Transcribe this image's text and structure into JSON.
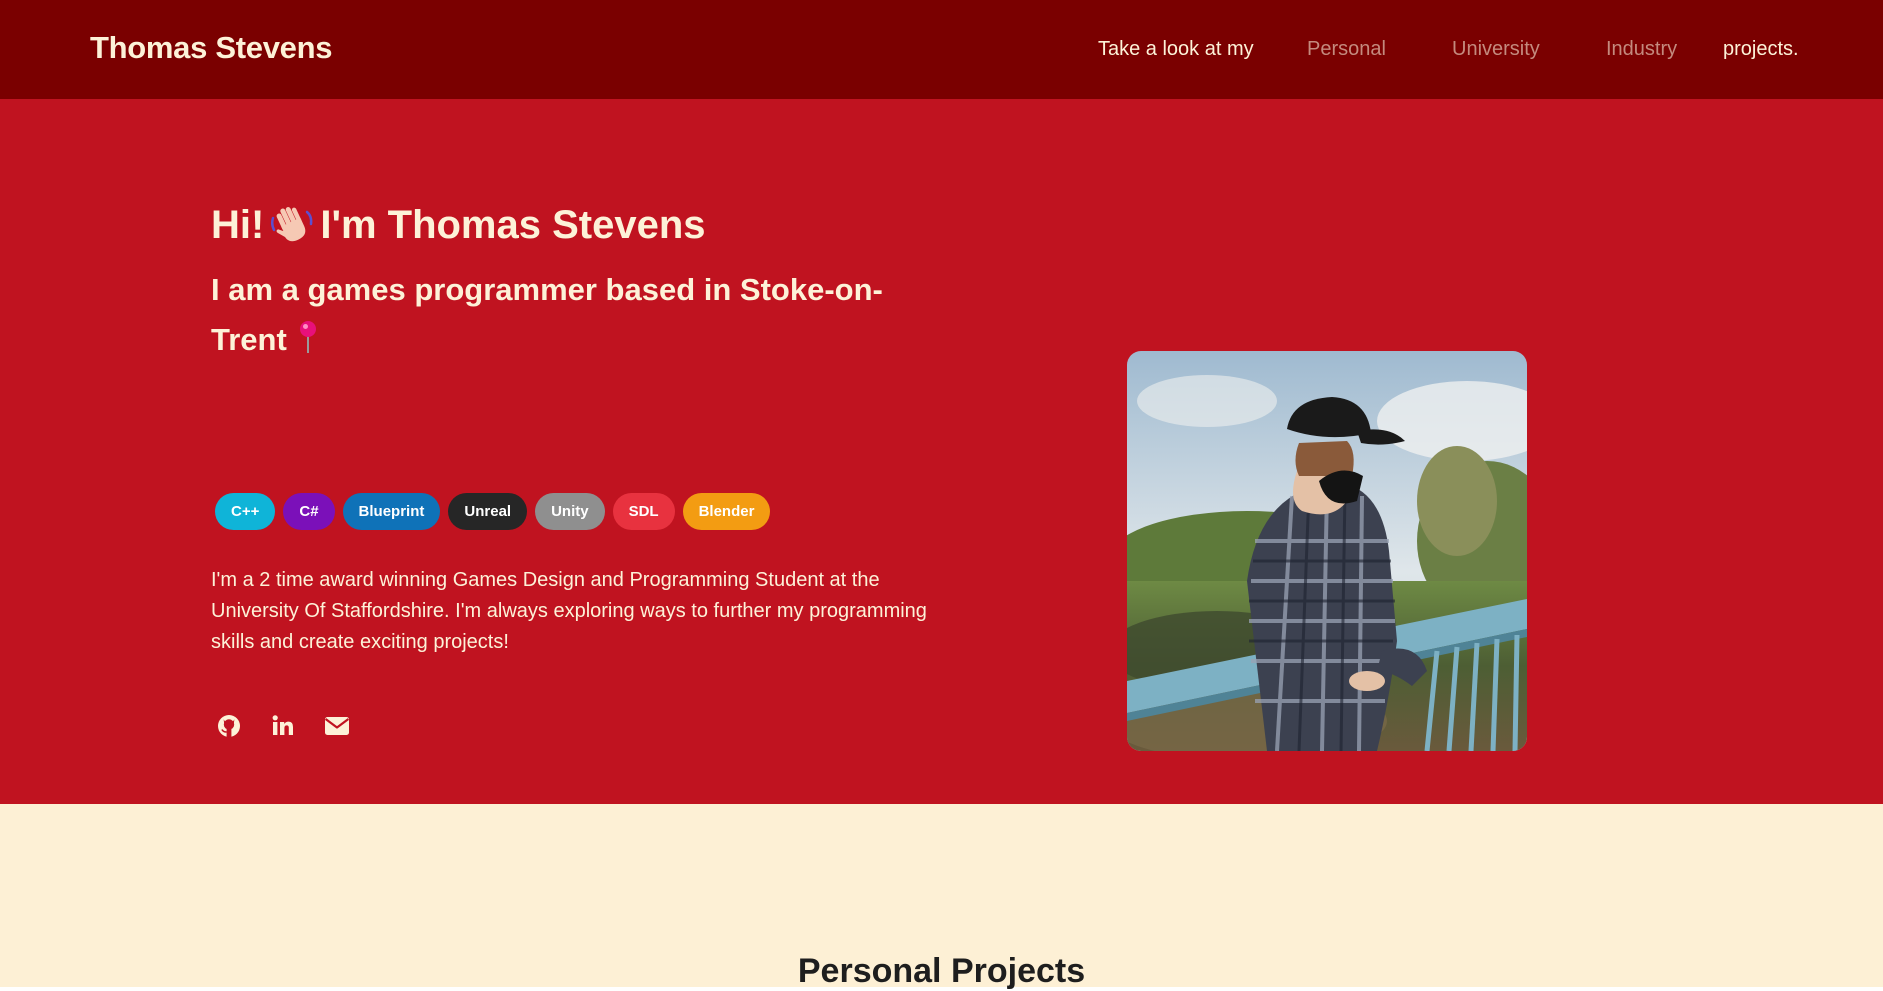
{
  "nav": {
    "brand": "Thomas Stevens",
    "prefix": "Take a look at my",
    "links": [
      "Personal",
      "University",
      "Industry"
    ],
    "suffix": "projects."
  },
  "hero": {
    "greeting_before": "Hi!",
    "greeting_emoji": "waving-hand-icon",
    "greeting_after": "I'm Thomas Stevens",
    "tagline": "I am a games programmer based in Stoke-on-Trent",
    "tagline_emoji": "round-pushpin-icon",
    "skills": [
      {
        "label": "C++",
        "color": "#0fb4d8",
        "text_color": "#ffffff"
      },
      {
        "label": "C#",
        "color": "#7b10b9",
        "text_color": "#ffffff"
      },
      {
        "label": "Blueprint",
        "color": "#0f72b8",
        "text_color": "#ffffff"
      },
      {
        "label": "Unreal",
        "color": "#262626",
        "text_color": "#ffffff"
      },
      {
        "label": "Unity",
        "color": "#8f8f8f",
        "text_color": "#ffffff"
      },
      {
        "label": "SDL",
        "color": "#e8323f",
        "text_color": "#ffffff"
      },
      {
        "label": "Blender",
        "color": "#f39c12",
        "text_color": "#ffffff"
      }
    ],
    "bio": "I'm a 2 time award winning Games Design and Programming Student at the University Of Staffordshire. I'm always exploring ways to further my programming skills and create exciting projects!",
    "socials": [
      "github-icon",
      "linkedin-icon",
      "envelope-icon"
    ],
    "photo": "profile-photo"
  },
  "projects": {
    "heading": "Personal Projects"
  },
  "colors": {
    "nav_bg": "#7a0000",
    "hero_bg": "#c01320",
    "cream": "#fdf2d8",
    "projects_bg": "#fdf0d5",
    "muted_link": "#c48a7e"
  }
}
